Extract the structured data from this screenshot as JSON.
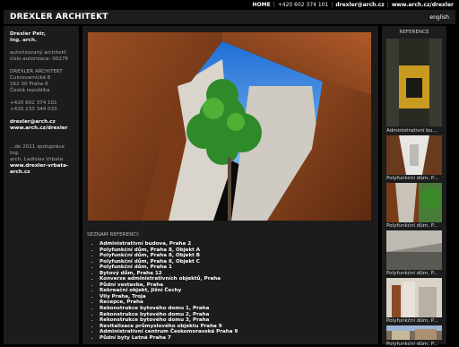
{
  "topbar": {
    "home": "HOME",
    "phone": "+420 602 374 101",
    "email": "drexler@arch.cz",
    "web": "www.arch.cz/drexler"
  },
  "header": {
    "title": "DREXLER ARCHITEKT",
    "language": "english"
  },
  "sidebar": {
    "name_line1": "Drexler Petr,",
    "name_line2": "Ing. arch.",
    "role1": "autorizovaný architekt",
    "role2": "číslo autorizace: 00276",
    "company": "DREXLER ARCHITEKT",
    "street": "Cukrovarnická 8",
    "city": "162 00 Praha 6",
    "country": "Česká republika",
    "phone1": "+420 602 374 101",
    "phone2": "+420 233 344 033",
    "email": "drexler@arch.cz",
    "web": "www.arch.cz/drexler",
    "coop1": "...do 2011 spolupráce Ing.",
    "coop2": "arch. Ladislav Vrbata",
    "coop_web1": "www.drexler-vrbata-",
    "coop_web2": "arch.cz"
  },
  "references": {
    "heading": "SEZNAM REFERENCÍ:",
    "items": [
      "Administrativní budova, Praha 2",
      "Polyfunkční dům, Praha 8, Objekt A",
      "Polyfunkční dům, Praha 8, Objekt B",
      "Polyfunkční dům, Praha 8, Objekt C",
      "Polyfunkční dům, Praha 1",
      "Bytový dům, Praha 12",
      "Konverze administrativních objektů, Praha",
      "Půdní vestavba, Praha",
      "Rekreační objekt, Jižní Čechy",
      "Vily Praha, Troja",
      "Recepce, Praha",
      "Rekonstrukce bytového domu 1, Praha",
      "Rekonstrukce bytového domu 2, Praha",
      "Rekonstrukce bytového domu 3, Praha",
      "Revitalizace průmyslového objektu Praha 9",
      "Administrativní centrum Českomoravská Praha 9",
      "Půdní byty Letná Praha 7"
    ]
  },
  "gallery": {
    "heading": "REFERENCE",
    "captions": [
      "Administrativní bu...",
      "Polyfunkční dům, P...",
      "Polyfunkční dům, P...",
      "Polyfunkční dům, P...",
      "Polyfunkční dům, P...",
      "Polyfunkční dům, P..."
    ]
  }
}
